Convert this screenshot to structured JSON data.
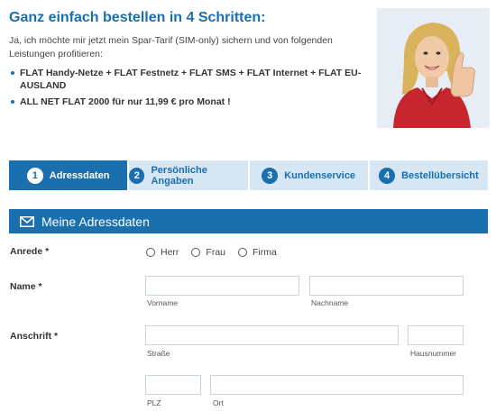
{
  "header": {
    "title": "Ganz einfach bestellen in 4 Schritten:",
    "intro": "Ja, ich möchte mir jetzt mein Spar-Tarif (SIM-only) sichern und von folgenden Leistungen profitieren:",
    "bullets": [
      "FLAT Handy-Netze + FLAT Festnetz + FLAT SMS + FLAT Internet + FLAT EU-AUSLAND",
      "ALL NET FLAT 2000 für nur 11,99 € pro Monat !"
    ]
  },
  "steps": [
    {
      "num": "1",
      "label": "Adressdaten",
      "active": true
    },
    {
      "num": "2",
      "label": "Persönliche Angaben",
      "active": false
    },
    {
      "num": "3",
      "label": "Kundenservice",
      "active": false
    },
    {
      "num": "4",
      "label": "Bestellübersicht",
      "active": false
    }
  ],
  "section": {
    "title": "Meine Adressdaten",
    "icon": "envelope-icon"
  },
  "form": {
    "anrede_label": "Anrede *",
    "anrede_options": [
      "Herr",
      "Frau",
      "Firma"
    ],
    "name_label": "Name *",
    "vorname_sub": "Vorname",
    "nachname_sub": "Nachname",
    "anschrift_label": "Anschrift *",
    "strasse_sub": "Straße",
    "hausnummer_sub": "Hausnummer",
    "plz_sub": "PLZ",
    "ort_sub": "Ort"
  },
  "colors": {
    "brand": "#1a6fae",
    "step_inactive": "#d7e6f3"
  }
}
